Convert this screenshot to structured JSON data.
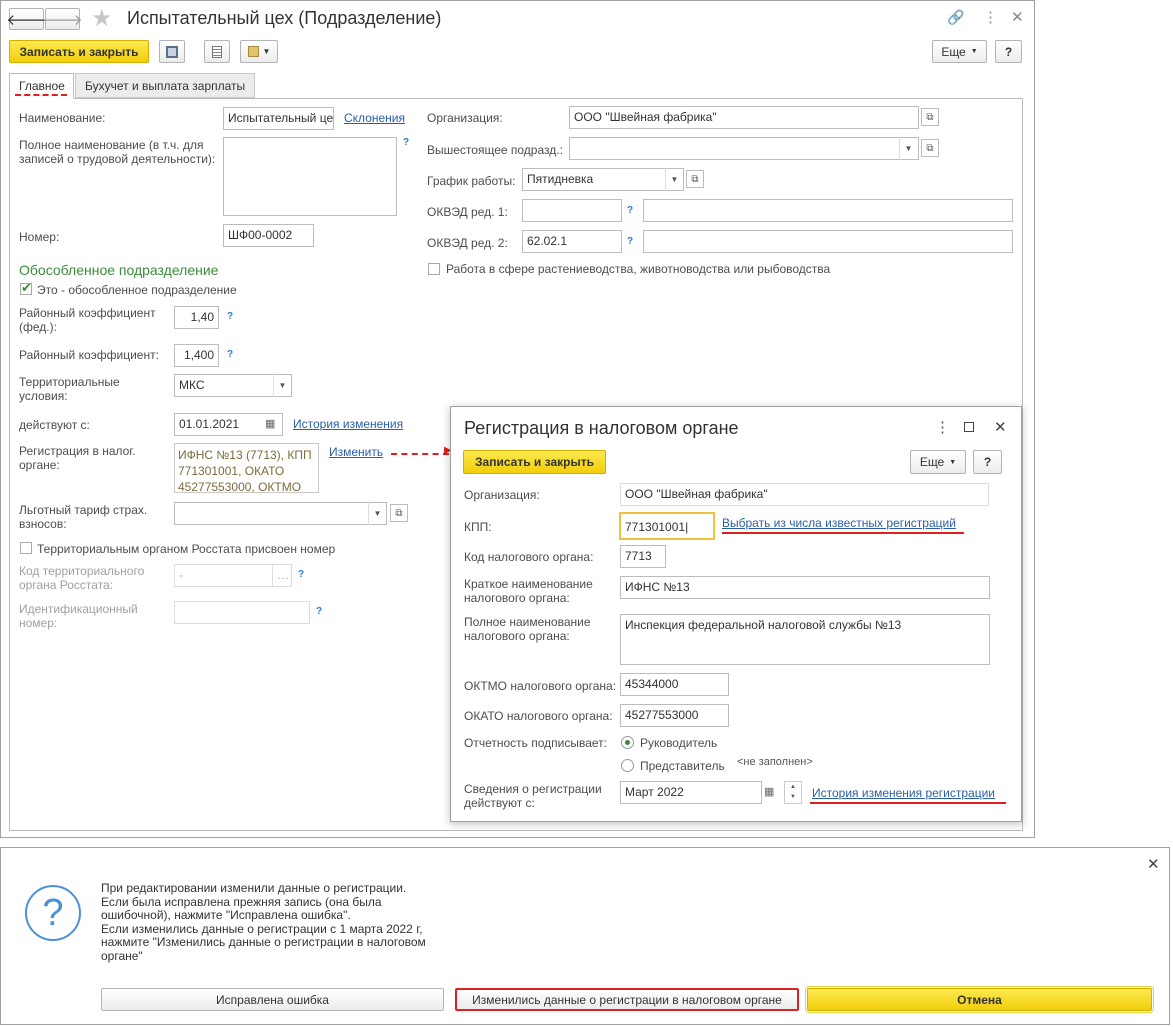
{
  "main_window": {
    "title": "Испытательный цех (Подразделение)",
    "save_close": "Записать и закрыть",
    "more": "Еще",
    "help": "?",
    "tabs": [
      "Главное",
      "Бухучет и выплата зарплаты"
    ],
    "left": {
      "name_label": "Наименование:",
      "name_value": "Испытательный цех",
      "declension_link": "Склонения",
      "full_name_label": "Полное наименование (в т.ч. для записей о трудовой деятельности):",
      "number_label": "Номер:",
      "number_value": "ШФ00-0002",
      "section_title": "Обособленное подразделение",
      "separate_check": "Это - обособленное подразделение",
      "rk_fed_label": "Районный коэффициент (фед.):",
      "rk_fed_value": "1,40",
      "rk_label": "Районный коэффициент:",
      "rk_value": "1,400",
      "terr_label": "Территориальные условия:",
      "terr_value": "МКС",
      "valid_label": "действуют с:",
      "valid_value": "01.01.2021",
      "history_link": "История изменения",
      "reg_label": "Регистрация в налог. органе:",
      "reg_value": "ИФНС №13 (7713), КПП 771301001, ОКАТО 45277553000, ОКТМО",
      "change_link": "Изменить",
      "tariff_label": "Льготный тариф страх. взносов:",
      "rosstat_check": "Территориальным органом Росстата присвоен номер",
      "rosstat_code_label": "Код территориального органа Росстата:",
      "rosstat_code_value": "-",
      "id_label": "Идентификационный номер:"
    },
    "right": {
      "org_label": "Организация:",
      "org_value": "ООО \"Швейная фабрика\"",
      "parent_label": "Вышестоящее подразд.:",
      "schedule_label": "График работы:",
      "schedule_value": "Пятидневка",
      "okved1_label": "ОКВЭД ред. 1:",
      "okved2_label": "ОКВЭД ред. 2:",
      "okved2_value": "62.02.1",
      "agri_check": "Работа в сфере растениеводства, животноводства или рыбоводства"
    }
  },
  "dialog": {
    "title": "Регистрация в налоговом органе",
    "save_close": "Записать и закрыть",
    "more": "Еще",
    "help": "?",
    "org_label": "Организация:",
    "org_value": "ООО \"Швейная фабрика\"",
    "kpp_label": "КПП:",
    "kpp_value": "771301001",
    "choose_link": "Выбрать из числа известных регистраций",
    "code_label": "Код налогового органа:",
    "code_value": "7713",
    "short_label": "Краткое наименование налогового органа:",
    "short_value": "ИФНС №13",
    "full_label": "Полное наименование налогового органа:",
    "full_value": "Инспекция федеральной налоговой службы №13",
    "oktmo_label": "ОКТМО налогового органа:",
    "oktmo_value": "45344000",
    "okato_label": "ОКАТО налогового органа:",
    "okato_value": "45277553000",
    "signs_label": "Отчетность подписывает:",
    "radio1": "Руководитель",
    "radio2": "Представитель",
    "not_filled": "<не заполнен>",
    "reg_valid_label": "Сведения о регистрации действуют с:",
    "reg_valid_value": "Март 2022",
    "history_link": "История изменения регистрации"
  },
  "message": {
    "text": "При редактировании изменили данные о регистрации.\nЕсли была исправлена прежняя запись (она была ошибочной), нажмите \"Исправлена ошибка\".\nЕсли изменились данные о регистрации с 1 марта 2022 г, нажмите \"Изменились данные о регистрации в налоговом органе\"",
    "btn_fixed": "Исправлена ошибка",
    "btn_changed": "Изменились данные о регистрации в налоговом органе",
    "btn_cancel": "Отмена"
  }
}
